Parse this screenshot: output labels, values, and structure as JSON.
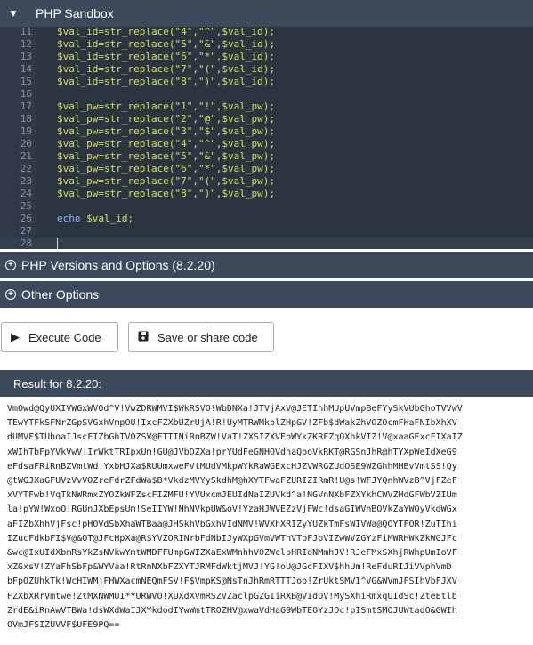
{
  "titlebar": {
    "title": "PHP Sandbox"
  },
  "editor": {
    "lines": [
      {
        "n": "11",
        "text": "$val_id=str_replace(\"4\",\"^\",$val_id);"
      },
      {
        "n": "12",
        "text": "$val_id=str_replace(\"5\",\"&\",$val_id);"
      },
      {
        "n": "13",
        "text": "$val_id=str_replace(\"6\",\"*\",$val_id);"
      },
      {
        "n": "14",
        "text": "$val_id=str_replace(\"7\",\"(\",$val_id);"
      },
      {
        "n": "15",
        "text": "$val_id=str_replace(\"8\",\")\",$val_id);"
      },
      {
        "n": "16",
        "text": ""
      },
      {
        "n": "17",
        "text": "$val_pw=str_replace(\"1\",\"!\",$val_pw);"
      },
      {
        "n": "18",
        "text": "$val_pw=str_replace(\"2\",\"@\",$val_pw);"
      },
      {
        "n": "19",
        "text": "$val_pw=str_replace(\"3\",\"$\",$val_pw);"
      },
      {
        "n": "20",
        "text": "$val_pw=str_replace(\"4\",\"^\",$val_pw);"
      },
      {
        "n": "21",
        "text": "$val_pw=str_replace(\"5\",\"&\",$val_pw);"
      },
      {
        "n": "22",
        "text": "$val_pw=str_replace(\"6\",\"*\",$val_pw);"
      },
      {
        "n": "23",
        "text": "$val_pw=str_replace(\"7\",\"(\",$val_pw);"
      },
      {
        "n": "24",
        "text": "$val_pw=str_replace(\"8\",\")\",$val_pw);"
      },
      {
        "n": "25",
        "text": ""
      },
      {
        "n": "26",
        "text_kw": "echo",
        "text_rest": " $val_id;"
      },
      {
        "n": "27",
        "text": ""
      },
      {
        "n": "28",
        "text": ""
      }
    ]
  },
  "sections": {
    "versions_label": "PHP Versions and Options (8.2.20)",
    "other_label": "Other Options"
  },
  "toolbar": {
    "execute_label": "Execute Code",
    "save_label": "Save or share code"
  },
  "result": {
    "header": "Result for 8.2.20:",
    "lines": [
      "VmOwd@QyUXIVWGxWVOd^V!VwZDRWMVI$WkRSVO!WbDNXa!JTVjAxV@JETIhhMUpUVmpBeFYySkVUbGhoTVVwV",
      "TEwYTFkSFNrZGpSVGxhVmpOU!IxcFZXbUZrUjA!R!UyMTRWMkplZHpGV!ZFb$dWakZhVOZOcmFHaFNIbXhXV",
      "dUMVF$TUhoaIJscFIZbGhTVOZSV@FTTINiRnBZW!VaT!ZXSIZXVEpWYkZKRFZqQXhkVIZ!V@xaaGExcFIXaIZ",
      "xWIhTbFpYVkVwV!IrWktTRIpxUm!GU@JVbDZXa!prYUdFeGNHOVdhaQpoVkRKT@RGSnJhR@hTYXpWeIdXeG9",
      "eFdsaFRiRnBZVmtWd!YxbHJXa$RUUmxweFVtMUdVMkpWYkRaWGExcHJZVWRGZUdOSE9WZGhhMHBvVmtSS!Qy",
      "@tWGJXaGFUVzVvVOZreFdrZFdWa$B*VkdzMVYySkdhM@hXYTFwaFZURIZIRmR!U@s!WFJYQnhWVzB^VjFZeF",
      "xVYTFwb!VqTkNWRmxZYOZkWFZscFIZMFU!YVUxcmJEUIdNaIZUVkd^a!NGVnNXbFZXYkhCWVZHdGFWbVZIUm",
      "la!pYW!WxoQ!RGUnJXbEpsUm!SeIIYW!NhNVkpUW&oV!YzaHJWVEZzVjFWc!dsaGIWVnBQVkZaYWQyVkdWGx",
      "aFIZbXhhVjFsc!pHOVdSbXhaWTBaa@JHSkhVbGxhVIdNMV!WVXhXRIZyYUZkTmFsWIVWa@QOYTFOR!ZuTIhi",
      "IZucFdkbFI$V@&OT@JFcHpXa@R$YVZORINrbFdNbIJyWXpGVmVWTnVTbFJpVIZwWVZGYzFiMWRHWkZkWGJFc",
      "&wc@IxUIdXbmRsYkZsNVkwYmtWMDFFUmpGWIZXaExWMnhhVOZWclpHRIdNMmhJV!RJeFMxSXhjRWhpUmIoVF",
      "xZGxsV!ZYaFhSbFp&WYVaa!RtRnNXbFZXYTJRMFdWktjMVJ!YG!oU@JGcFIXV$hhUm!ReFduRIJiVVphVmD",
      "bFpOZUhkTk!WcHIWMjFHWXacmNEQmFSV!F$VmpKS@NsTnJhRmRTTTJob!ZrUktSMVI^VG&WVmJFSIhVbFJXV",
      "FZXbXRrVmtwe!ZtMXNWMUI*YURWVO!XUXdXVmRSZVZaclpGZGIiRXB@VIdOV!MySXhiRmxqUIdSc!ZteEtlb",
      "ZrdE&iRnAwVTBWa!dsWXdWaIJXYkdodIYwWmtTROZHV@xwaVdHaG9WbTEOYzJOc!pISmtSMOJUWtadO&GWIh",
      "OVmJFSIZUVVF$UFE9PQ=="
    ]
  }
}
